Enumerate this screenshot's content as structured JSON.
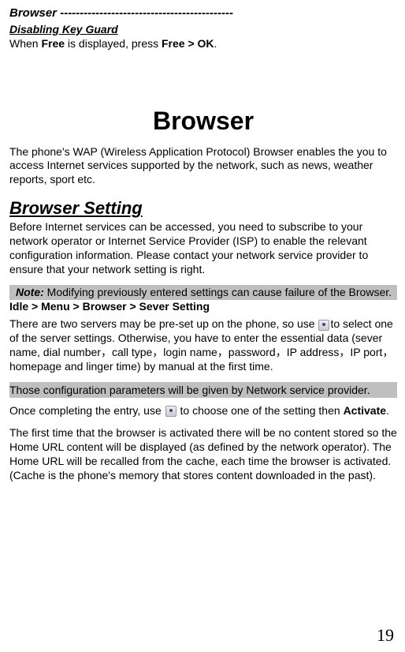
{
  "header": {
    "label": "Browser",
    "dashes": " --------------------------------------------"
  },
  "keyguard": {
    "heading": "Disabling Key Guard",
    "line_prefix": "When ",
    "line_bold1": "Free",
    "line_mid": " is displayed, press ",
    "line_bold2": "Free > OK",
    "line_end": "."
  },
  "title": "Browser",
  "intro": "The phone's WAP (Wireless Application Protocol) Browser enables the you to access Internet services supported by the network, such as news, weather reports, sport etc.",
  "setting": {
    "heading": "Browser Setting",
    "para1": "Before Internet services can be accessed, you need to subscribe to your network operator or Internet Service Provider (ISP) to enable the relevant configuration information. Please contact your network service provider to ensure that your network setting is right.",
    "note_label": "Note:",
    "note_text": " Modifying previously entered settings can cause failure of the Browser.",
    "path": "Idle > Menu > Browser > Sever Setting",
    "para2_a": "There are two servers may be pre-set up on the phone, so use ",
    "para2_b": "to select one of the server settings. Otherwise, you have to enter the essential data (sever name, dial number，call type，login name，password，IP address，IP port，homepage and linger time) by manual at the first time.",
    "gray_para": "Those configuration parameters will be given by Network service provider.",
    "para3_a": "Once completing the entry, use ",
    "para3_b": " to choose one of the setting then ",
    "para3_bold": "Activate",
    "para3_c": ".",
    "para4": "The first time that the browser is activated there will be no content stored so the Home URL content will be displayed (as defined by the network operator). The Home URL will be recalled from the cache, each time the browser is activated. (Cache is the phone's memory that stores content downloaded in the past)."
  },
  "page_number": "19"
}
